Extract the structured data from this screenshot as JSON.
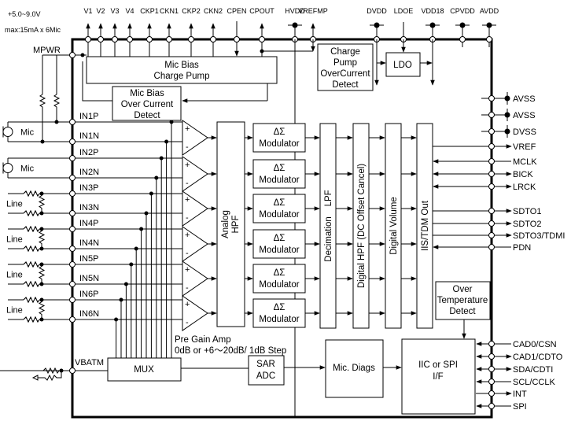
{
  "supply_note": {
    "line1": "+5.0~9.0V",
    "line2": "max:15mA x 6Mic"
  },
  "mpwr_label": "MPWR",
  "top_pins": [
    "V1",
    "V2",
    "V3",
    "V4",
    "CKP1",
    "CKN1",
    "CKP2",
    "CKN2",
    "CPEN",
    "CPOUT",
    "HVDD",
    "VREFMP",
    "DVDD",
    "LDOE",
    "VDD18",
    "CPVDD",
    "AVDD"
  ],
  "blocks": {
    "mic_bias_cp": [
      "Mic Bias",
      "Charge Pump"
    ],
    "mic_bias_ocd": [
      "Mic Bias",
      "Over Current",
      "Detect"
    ],
    "cp_ocd": [
      "Charge",
      "Pump",
      "OverCurrent",
      "Detect"
    ],
    "ldo": "LDO",
    "analog_hpf": [
      "Analog",
      "HPF"
    ],
    "modulator": [
      "ΔΣ",
      "Modulator"
    ],
    "decimation_lpf": "Decimation    LPF",
    "digital_hpf": "Digital HPF (DC Offset Cancel)",
    "digital_volume": "Digital Volume",
    "iis_tdm": "IIS/TDM Out",
    "over_temp": [
      "Over",
      "Temperature",
      "Detect"
    ],
    "mux": "MUX",
    "sar_adc": [
      "SAR",
      "ADC"
    ],
    "mic_diags": "Mic. Diags",
    "iic_spi": [
      "IIC or SPI",
      "I/F"
    ]
  },
  "input_pins": [
    "IN1P",
    "IN1N",
    "IN2P",
    "IN2N",
    "IN3P",
    "IN3N",
    "IN4P",
    "IN4N",
    "IN5P",
    "IN5N",
    "IN6P",
    "IN6N"
  ],
  "vbatm_label": "VBATM",
  "sources": [
    "Mic",
    "Mic",
    "Line",
    "Line",
    "Line",
    "Line"
  ],
  "pre_gain": {
    "line1": "Pre Gain Amp",
    "line2": "0dB or +6～20dB/ 1dB Step"
  },
  "amp_signs": {
    "plus": "+",
    "minus": "-"
  },
  "right_pins": [
    "AVSS",
    "AVSS",
    "DVSS",
    "VREF",
    "MCLK",
    "BICK",
    "LRCK",
    "SDTO1",
    "SDTO2",
    "SDTO3/TDMI",
    "PDN",
    "CAD0/CSN",
    "CAD1/CDTO",
    "SDA/CDTI",
    "SCL/CCLK",
    "INT",
    "SPI"
  ]
}
